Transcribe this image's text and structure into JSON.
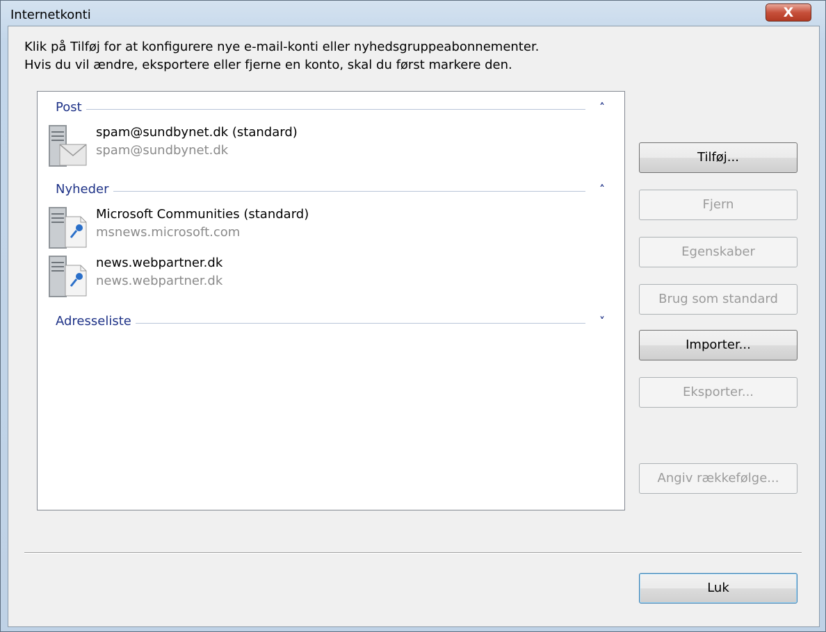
{
  "window": {
    "title": "Internetkonti"
  },
  "instructions": {
    "line1": "Klik på Tilføj for at konfigurere nye e-mail-konti eller nyhedsgruppeabonnementer.",
    "line2": "Hvis du vil ændre, eksportere eller fjerne en konto, skal du først markere den."
  },
  "groups": {
    "post": {
      "label": "Post",
      "state": "expanded"
    },
    "news": {
      "label": "Nyheder",
      "state": "expanded"
    },
    "directory": {
      "label": "Adresseliste",
      "state": "collapsed"
    }
  },
  "accounts": [
    {
      "name": "spam@sundbynet.dk (standard)",
      "server": "spam@sundbynet.dk",
      "icon": "mail-account-icon"
    },
    {
      "name": "Microsoft Communities (standard)",
      "server": "msnews.microsoft.com",
      "icon": "news-account-icon"
    },
    {
      "name": "news.webpartner.dk",
      "server": "news.webpartner.dk",
      "icon": "news-account-icon"
    }
  ],
  "buttons": {
    "add": {
      "label": "Tilføj...",
      "enabled": true
    },
    "remove": {
      "label": "Fjern",
      "enabled": false
    },
    "properties": {
      "label": "Egenskaber",
      "enabled": false
    },
    "set_default": {
      "label": "Brug som standard",
      "enabled": false
    },
    "import": {
      "label": "Importer...",
      "enabled": true
    },
    "export": {
      "label": "Eksporter...",
      "enabled": false
    },
    "set_order": {
      "label": "Angiv rækkefølge...",
      "enabled": false
    },
    "close": {
      "label": "Luk",
      "enabled": true
    }
  },
  "close_glyph": "X"
}
